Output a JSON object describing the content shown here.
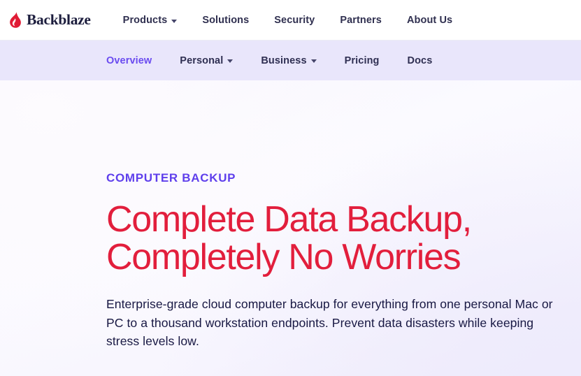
{
  "brand": {
    "name": "Backblaze",
    "logo_icon": "flame-droplet-icon",
    "logo_color": "#e01b35",
    "wordmark_color": "#1c1d3d"
  },
  "topnav": {
    "items": [
      {
        "label": "Products",
        "has_dropdown": true
      },
      {
        "label": "Solutions",
        "has_dropdown": false
      },
      {
        "label": "Security",
        "has_dropdown": false
      },
      {
        "label": "Partners",
        "has_dropdown": false
      },
      {
        "label": "About Us",
        "has_dropdown": false
      }
    ]
  },
  "subnav": {
    "background": "#e9e6fb",
    "active_color": "#6a4bf0",
    "items": [
      {
        "label": "Overview",
        "has_dropdown": false,
        "active": true
      },
      {
        "label": "Personal",
        "has_dropdown": true,
        "active": false
      },
      {
        "label": "Business",
        "has_dropdown": true,
        "active": false
      },
      {
        "label": "Pricing",
        "has_dropdown": false,
        "active": false
      },
      {
        "label": "Docs",
        "has_dropdown": false,
        "active": false
      }
    ]
  },
  "hero": {
    "eyebrow": "COMPUTER BACKUP",
    "eyebrow_color": "#5f3fec",
    "headline_color": "#e21e3c",
    "headline_line_1": "Complete Data Backup,",
    "headline_line_2": "Completely No Worries",
    "lede": "Enterprise-grade cloud computer backup for everything from one personal Mac or PC to a thousand workstation endpoints. Prevent data disasters while keeping stress levels low.",
    "lede_color": "#181843"
  }
}
